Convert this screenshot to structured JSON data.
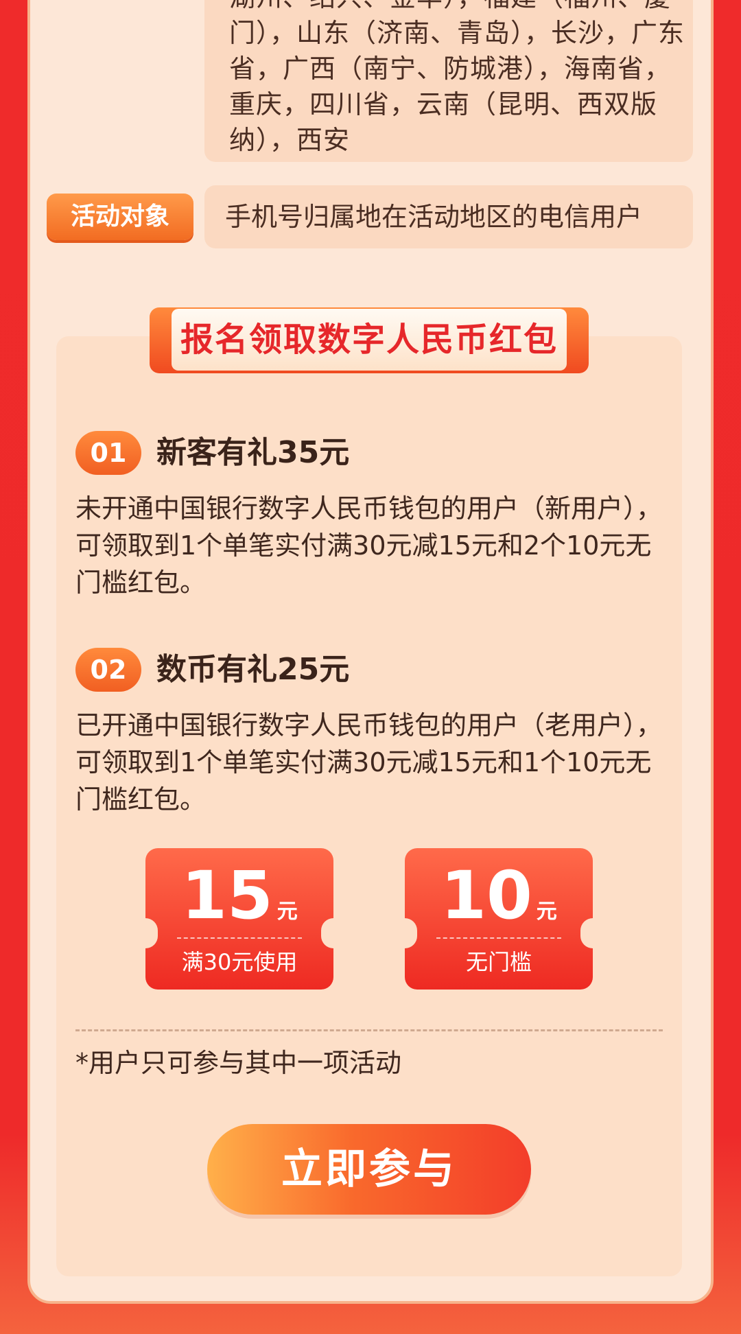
{
  "regions": {
    "text": "湖州、绍兴、金华），福建（福州、厦门），山东（济南、青岛），长沙，广东省，广西（南宁、防城港），海南省，重庆，四川省，云南（昆明、西双版纳），西安"
  },
  "target": {
    "tag": "活动对象",
    "text": "手机号归属地在活动地区的电信用户"
  },
  "signup": {
    "title": "报名领取数字人民币红包",
    "items": [
      {
        "num": "01",
        "title": "新客有礼35元",
        "desc": "未开通中国银行数字人民币钱包的用户（新用户），可领取到1个单笔实付满30元减15元和2个10元无门槛红包。"
      },
      {
        "num": "02",
        "title": "数币有礼25元",
        "desc": "已开通中国银行数字人民币钱包的用户（老用户），可领取到1个单笔实付满30元减15元和1个10元无门槛红包。"
      }
    ],
    "coupons": [
      {
        "amount": "15",
        "unit": "元",
        "condition": "满30元使用"
      },
      {
        "amount": "10",
        "unit": "元",
        "condition": "无门槛"
      }
    ],
    "note": "*用户只可参与其中一项活动",
    "cta": "立即参与"
  },
  "colors": {
    "page_red": "#ee2a2a",
    "card_bg": "#fde7d7",
    "accent_orange": "#f26c22",
    "title_red": "#e6272a"
  }
}
